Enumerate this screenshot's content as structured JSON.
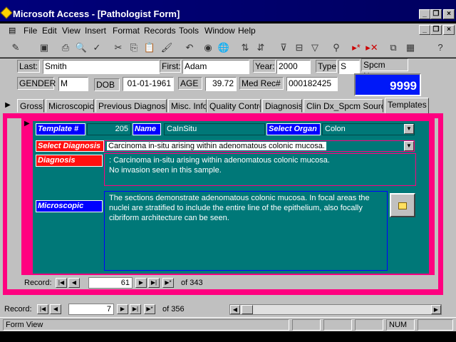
{
  "app": {
    "title": "Microsoft Access - [Pathologist Form]"
  },
  "menu": [
    "File",
    "Edit",
    "View",
    "Insert",
    "Format",
    "Records",
    "Tools",
    "Window",
    "Help"
  ],
  "header": {
    "last_label": "Last:",
    "last_value": "Smith",
    "first_label": "First:",
    "first_value": "Adam",
    "year_label": "Year:",
    "year_value": "2000",
    "type_label": "Type",
    "type_value": "S",
    "spcm_label": "Spcm Num:",
    "spcm_value": "9999",
    "gender_label": "GENDER",
    "gender_value": "M",
    "dob_label": "DOB",
    "dob_value": "01-01-1961",
    "age_label": "AGE",
    "age_value": "39.72",
    "medrec_label": "Med Rec#",
    "medrec_value": "000182425"
  },
  "tabs": [
    "Gross",
    "Microscopic",
    "Previous Diagnosis",
    "Misc. Info",
    "Quality Control",
    "Diagnosis",
    "Clin Dx_Spcm Source",
    "Templates"
  ],
  "template": {
    "template_no_label": "Template #",
    "template_no_value": "205",
    "name_label": "Name",
    "name_value": "CaInSitu",
    "select_organ_label": "Select Organ",
    "select_organ_value": "Colon",
    "select_diagnosis_label": "Select Diagnosis",
    "select_diagnosis_value": "Carcinoma in-situ arising within adenomatous colonic mucosa.",
    "diagnosis_label": "Diagnosis",
    "diagnosis_line1": ": Carcinoma in-situ arising within adenomatous colonic mucosa.",
    "diagnosis_line2": "No invasion seen in this sample.",
    "microscopic_label": "Microscopic",
    "microscopic_text": "The sections demonstrate adenomatous colonic mucosa. In focal areas the nuclei are stratified to include the entire line of the epithelium, also focally cibriform architecture can be seen."
  },
  "subform_nav": {
    "label": "Record:",
    "current": "61",
    "of": "of  343"
  },
  "main_nav": {
    "label": "Record:",
    "current": "7",
    "of": "of  356"
  },
  "status": {
    "left": "Form View",
    "num": "NUM"
  }
}
